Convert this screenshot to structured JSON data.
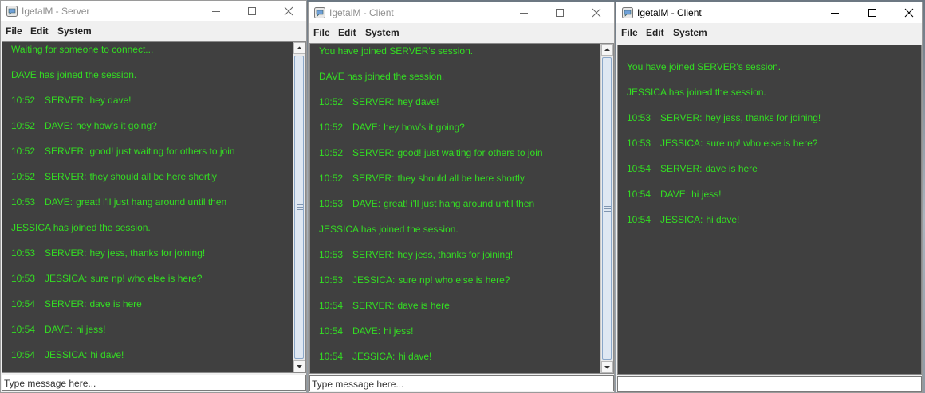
{
  "menus": [
    "File",
    "Edit",
    "System"
  ],
  "windows": [
    {
      "title": "IgetalM - Server",
      "input_value": "Type message here...",
      "messages": [
        {
          "text": "Waiting for someone to connect..."
        },
        {
          "text": "DAVE has joined the session."
        },
        {
          "time": "10:52",
          "name": "SERVER:",
          "text": "hey dave!"
        },
        {
          "time": "10:52",
          "name": "DAVE:",
          "text": "hey how's it going?"
        },
        {
          "time": "10:52",
          "name": "SERVER:",
          "text": "good! just waiting for others to join"
        },
        {
          "time": "10:52",
          "name": "SERVER:",
          "text": "they should all be here shortly"
        },
        {
          "time": "10:53",
          "name": "DAVE:",
          "text": "great! i'll just hang around until then"
        },
        {
          "text": "JESSICA has joined the session."
        },
        {
          "time": "10:53",
          "name": "SERVER:",
          "text": "hey jess, thanks for joining!"
        },
        {
          "time": "10:53",
          "name": "JESSICA:",
          "text": "sure np! who else is here?"
        },
        {
          "time": "10:54",
          "name": "SERVER:",
          "text": "dave is here"
        },
        {
          "time": "10:54",
          "name": "DAVE:",
          "text": "hi jess!"
        },
        {
          "time": "10:54",
          "name": "JESSICA:",
          "text": "hi dave!"
        }
      ]
    },
    {
      "title": "IgetalM - Client",
      "input_value": "Type message here...",
      "messages": [
        {
          "text": "You have joined SERVER's session."
        },
        {
          "text": "DAVE has joined the session."
        },
        {
          "time": "10:52",
          "name": "SERVER:",
          "text": "hey dave!"
        },
        {
          "time": "10:52",
          "name": "DAVE:",
          "text": "hey how's it going?"
        },
        {
          "time": "10:52",
          "name": "SERVER:",
          "text": "good! just waiting for others to join"
        },
        {
          "time": "10:52",
          "name": "SERVER:",
          "text": "they should all be here shortly"
        },
        {
          "time": "10:53",
          "name": "DAVE:",
          "text": "great! i'll just hang around until then"
        },
        {
          "text": "JESSICA has joined the session."
        },
        {
          "time": "10:53",
          "name": "SERVER:",
          "text": "hey jess, thanks for joining!"
        },
        {
          "time": "10:53",
          "name": "JESSICA:",
          "text": "sure np! who else is here?"
        },
        {
          "time": "10:54",
          "name": "SERVER:",
          "text": "dave is here"
        },
        {
          "time": "10:54",
          "name": "DAVE:",
          "text": "hi jess!"
        },
        {
          "time": "10:54",
          "name": "JESSICA:",
          "text": "hi dave!"
        }
      ]
    },
    {
      "title": "IgetalM - Client",
      "input_value": "",
      "messages": [
        {
          "text": "You have joined SERVER's session."
        },
        {
          "text": "JESSICA has joined the session."
        },
        {
          "time": "10:53",
          "name": "SERVER:",
          "text": "hey jess, thanks for joining!"
        },
        {
          "time": "10:53",
          "name": "JESSICA:",
          "text": "sure np! who else is here?"
        },
        {
          "time": "10:54",
          "name": "SERVER:",
          "text": "dave is here"
        },
        {
          "time": "10:54",
          "name": "DAVE:",
          "text": "hi jess!"
        },
        {
          "time": "10:54",
          "name": "JESSICA:",
          "text": "hi dave!"
        }
      ]
    }
  ],
  "colors": {
    "chat_bg": "#404040",
    "chat_text": "#33dd22",
    "titlebar": "#ffffff",
    "window": "#f0f0f0"
  }
}
